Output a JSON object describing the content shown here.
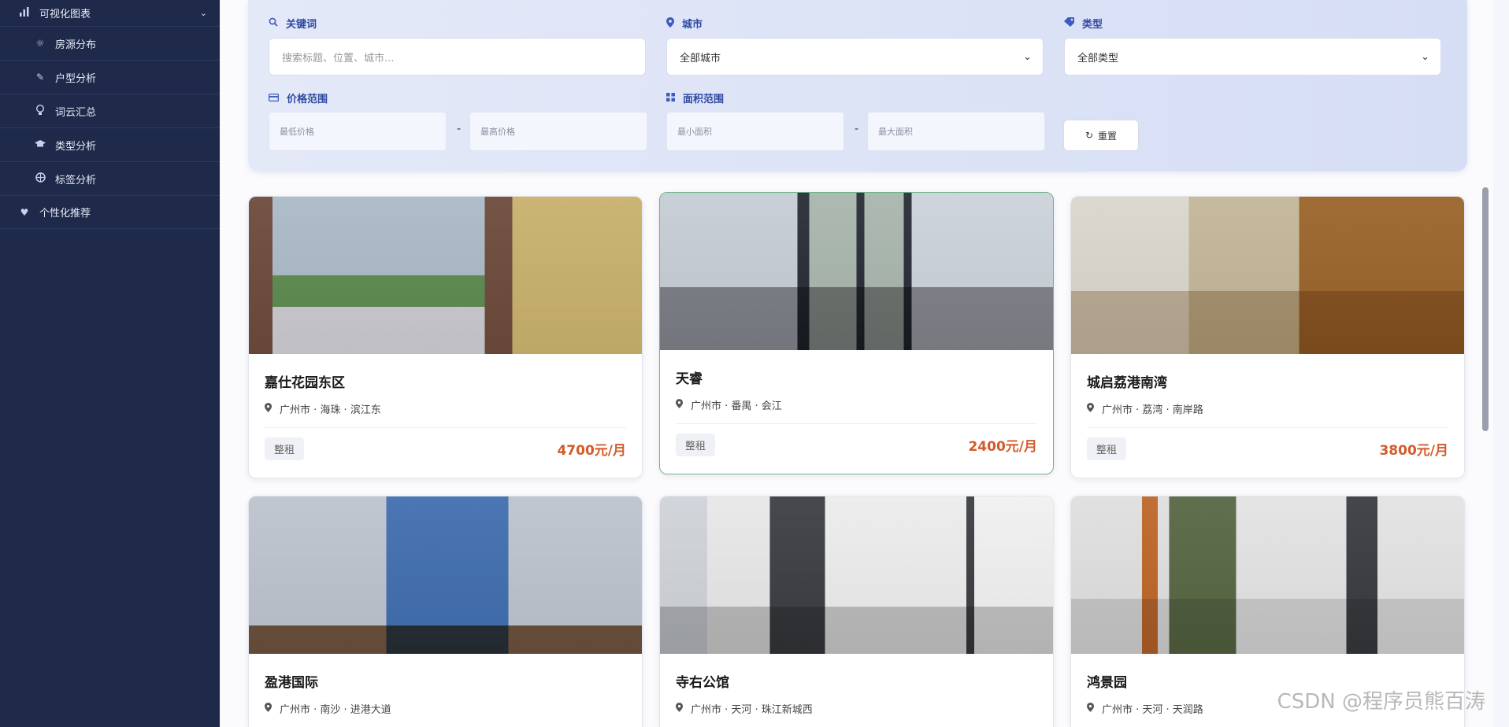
{
  "sidebar": {
    "parent": {
      "label": "可视化图表",
      "icon": "bar-chart-icon"
    },
    "items": [
      {
        "label": "房源分布",
        "icon": "sun-icon"
      },
      {
        "label": "户型分析",
        "icon": "feather-icon"
      },
      {
        "label": "词云汇总",
        "icon": "lightbulb-icon"
      },
      {
        "label": "类型分析",
        "icon": "graduation-cap-icon"
      },
      {
        "label": "标签分析",
        "icon": "basketball-icon"
      }
    ],
    "recommend": {
      "label": "个性化推荐",
      "icon": "heart-icon"
    }
  },
  "filter": {
    "keyword": {
      "label": "关键词",
      "placeholder": "搜索标题、位置、城市..."
    },
    "city": {
      "label": "城市",
      "value": "全部城市"
    },
    "type": {
      "label": "类型",
      "value": "全部类型"
    },
    "price": {
      "label": "价格范围",
      "min_placeholder": "最低价格",
      "max_placeholder": "最高价格"
    },
    "area": {
      "label": "面积范围",
      "min_placeholder": "最小面积",
      "max_placeholder": "最大面积"
    },
    "dash": "-",
    "reset_label": "重置"
  },
  "listings": [
    {
      "title": "嘉仕花园东区",
      "location": "广州市 · 海珠 · 滨江东",
      "badge": "整租",
      "price": "4700元/月"
    },
    {
      "title": "天睿",
      "location": "广州市 · 番禺 · 会江",
      "badge": "整租",
      "price": "2400元/月"
    },
    {
      "title": "城启荔港南湾",
      "location": "广州市 · 荔湾 · 南岸路",
      "badge": "整租",
      "price": "3800元/月"
    },
    {
      "title": "盈港国际",
      "location": "广州市 · 南沙 · 进港大道"
    },
    {
      "title": "寺右公馆",
      "location": "广州市 · 天河 · 珠江新城西"
    },
    {
      "title": "鸿景园",
      "location": "广州市 · 天河 · 天润路"
    }
  ],
  "watermark": "CSDN @程序员熊百涛",
  "colors": {
    "sidebar_bg": "#1f2a4b",
    "accent": "#2f4aa3",
    "price": "#d35b2b",
    "active_border": "#6cb386"
  }
}
